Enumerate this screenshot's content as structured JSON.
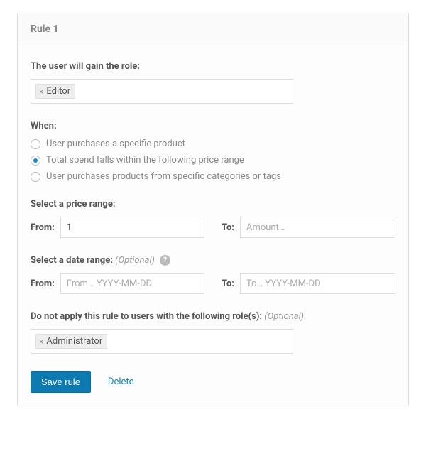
{
  "panel": {
    "title": "Rule 1"
  },
  "gainRole": {
    "label": "The user will gain the role:",
    "tags": [
      "Editor"
    ]
  },
  "when": {
    "label": "When:",
    "options": [
      {
        "label": "User purchases a specific product",
        "checked": false
      },
      {
        "label": "Total spend falls within the following price range",
        "checked": true
      },
      {
        "label": "User purchases products from specific categories or tags",
        "checked": false
      }
    ]
  },
  "priceRange": {
    "label": "Select a price range:",
    "fromLabel": "From:",
    "toLabel": "To:",
    "fromValue": "1",
    "toPlaceholder": "Amount…"
  },
  "dateRange": {
    "label": "Select a date range:",
    "optional": "(Optional)",
    "fromLabel": "From:",
    "toLabel": "To:",
    "fromPlaceholder": "From… YYYY-MM-DD",
    "toPlaceholder": "To… YYYY-MM-DD"
  },
  "excludeRoles": {
    "label": "Do not apply this rule to users with the following role(s):",
    "optional": "(Optional)",
    "tags": [
      "Administrator"
    ]
  },
  "actions": {
    "save": "Save rule",
    "delete": "Delete"
  }
}
